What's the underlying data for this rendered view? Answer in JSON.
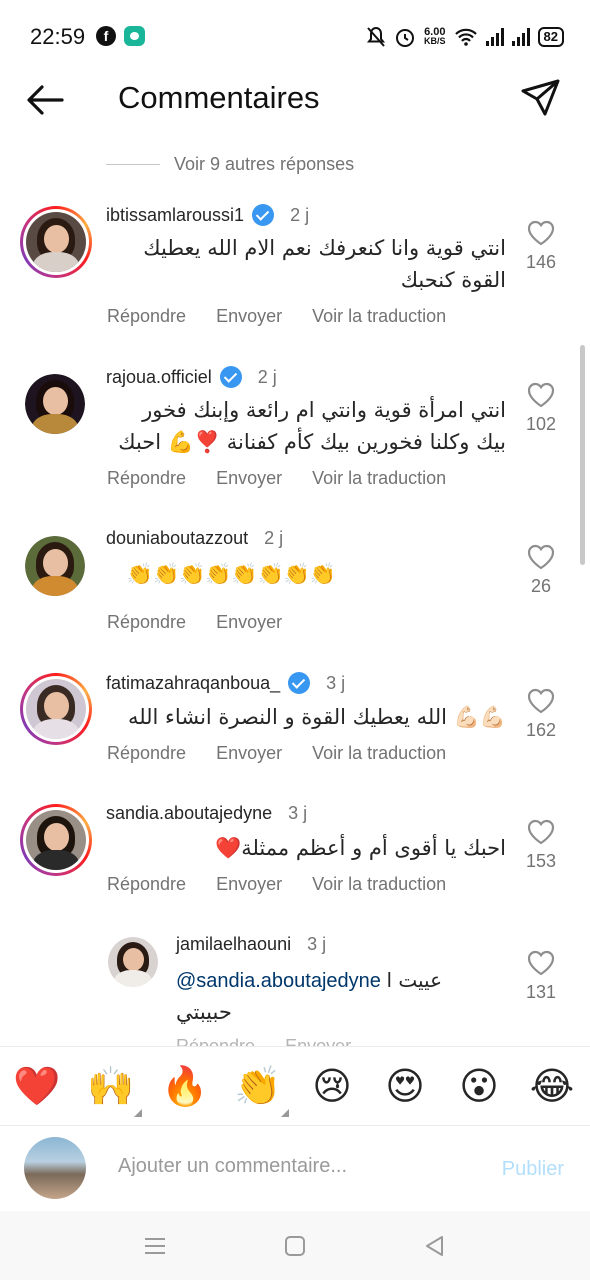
{
  "status_bar": {
    "time": "22:59",
    "net_speed_value": "6.00",
    "net_speed_unit": "KB/S",
    "battery": "82"
  },
  "header": {
    "title": "Commentaires"
  },
  "view_replies": "Voir 9 autres réponses",
  "comments": [
    {
      "username": "ibtissamlaroussi1",
      "verified": true,
      "time": "2 j",
      "text": "انتي قوية وانا كنعرفك نعم الام الله يعطيك القوة كنحبك",
      "reply": "Répondre",
      "send": "Envoyer",
      "translate": "Voir la traduction",
      "likes": "146",
      "story_ring": true
    },
    {
      "username": "rajoua.officiel",
      "verified": true,
      "time": "2 j",
      "text": "انتي امرأة قوية وانتي ام رائعة وإبنك فخور بيك وكلنا فخورين بيك كأم كفنانة ❣️💪 احبك",
      "reply": "Répondre",
      "send": "Envoyer",
      "translate": "Voir la traduction",
      "likes": "102",
      "story_ring": false
    },
    {
      "username": "douniaboutazzout",
      "verified": false,
      "time": "2 j",
      "text": "👏👏👏👏👏👏👏👏",
      "reply": "Répondre",
      "send": "Envoyer",
      "likes": "26",
      "story_ring": false
    },
    {
      "username": "fatimazahraqanboua_",
      "verified": true,
      "time": "3 j",
      "text": "💪🏻💪🏻 الله يعطيك القوة و النصرة انشاء الله",
      "reply": "Répondre",
      "send": "Envoyer",
      "translate": "Voir la traduction",
      "likes": "162",
      "story_ring": true
    },
    {
      "username": "sandia.aboutajedyne",
      "verified": false,
      "time": "3 j",
      "text": "احبك يا أقوى أم و أعظم ممثلة❤️",
      "reply": "Répondre",
      "send": "Envoyer",
      "translate": "Voir la traduction",
      "likes": "153",
      "story_ring": true
    }
  ],
  "reply_comment": {
    "username": "jamilaelhaouni",
    "time": "3 j",
    "mention": "@sandia.aboutajedyne",
    "text": "عييت ا",
    "text_line2": "حبيبتي",
    "reply": "Répondre",
    "send": "Envoyer",
    "likes": "131"
  },
  "reactions": [
    "❤️",
    "🙌",
    "🔥",
    "👏",
    "😢",
    "😍",
    "😮",
    "😂"
  ],
  "composer": {
    "placeholder": "Ajouter un commentaire...",
    "publish": "Publier"
  },
  "icons": {
    "back": "arrow-left-icon",
    "send": "paper-plane-icon",
    "like": "heart-outline-icon",
    "verified": "verified-badge-icon",
    "nav_menu": "menu-icon",
    "nav_home": "square-home-icon",
    "nav_back": "triangle-back-icon"
  },
  "colors": {
    "verified": "#3897f0",
    "publish_disabled": "#b2dffc",
    "muted": "#737373"
  }
}
